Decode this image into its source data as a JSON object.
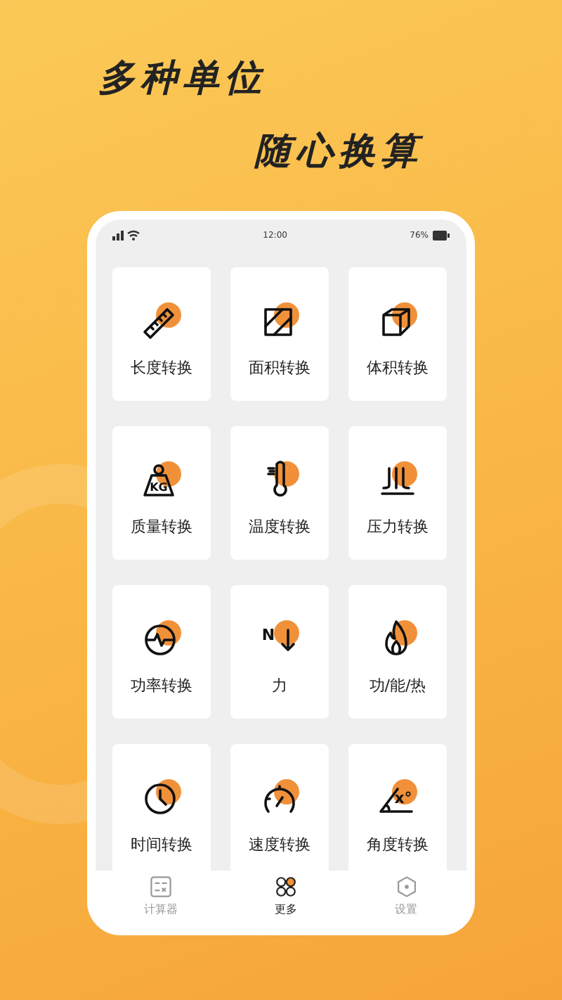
{
  "headline": [
    "多种单位",
    "随心换算"
  ],
  "status_bar": {
    "time": "12:00",
    "battery": "76%"
  },
  "tools": [
    {
      "label": "长度转换",
      "kind": "ruler"
    },
    {
      "label": "面积转换",
      "kind": "area"
    },
    {
      "label": "体积转换",
      "kind": "cube"
    },
    {
      "label": "质量转换",
      "kind": "weight",
      "icon_text": "KG"
    },
    {
      "label": "温度转换",
      "kind": "thermometer"
    },
    {
      "label": "压力转换",
      "kind": "pressure"
    },
    {
      "label": "功率转换",
      "kind": "power"
    },
    {
      "label": "力",
      "kind": "force",
      "icon_text": "N"
    },
    {
      "label": "功/能/热",
      "kind": "flame"
    },
    {
      "label": "时间转换",
      "kind": "clock"
    },
    {
      "label": "速度转换",
      "kind": "speed"
    },
    {
      "label": "角度转换",
      "kind": "angle",
      "icon_text": "x°"
    }
  ],
  "tab_bar": [
    {
      "label": "计算器",
      "kind": "calculator",
      "selected": false
    },
    {
      "label": "更多",
      "kind": "grid",
      "selected": true
    },
    {
      "label": "设置",
      "kind": "hexagon",
      "selected": false
    }
  ]
}
